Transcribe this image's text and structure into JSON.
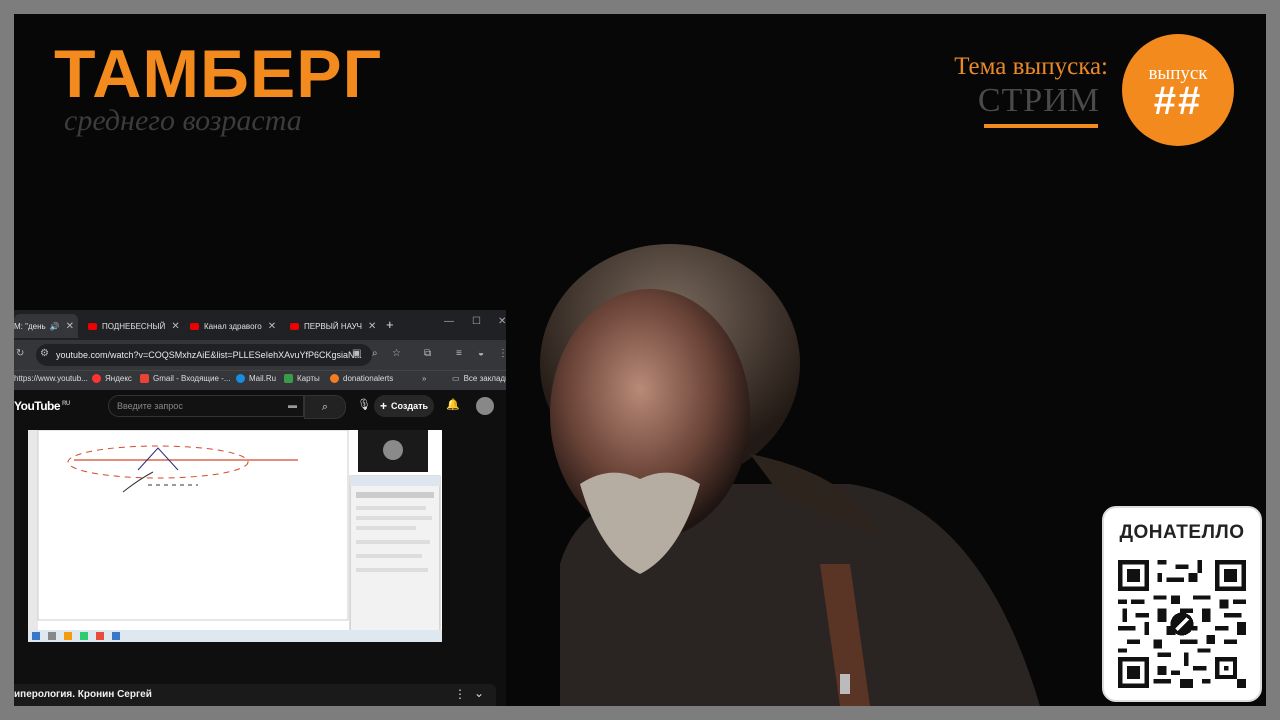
{
  "overlay": {
    "brand_main": "ТАМБЕРГ",
    "brand_sub": "среднего возраста",
    "theme_label": "Тема выпуска:",
    "theme_value": "СТРИМ",
    "badge_top": "выпуск",
    "badge_number": "##",
    "donate_title": "ДОНАТЕЛЛО",
    "accent_color": "#f28a1e"
  },
  "browser": {
    "tabs": [
      {
        "label": "M: \"день"
      },
      {
        "label": "ПОДНЕБЕСНЫЙ"
      },
      {
        "label": "Канал здравого"
      },
      {
        "label": "ПЕРВЫЙ НАУЧ"
      }
    ],
    "url": "youtube.com/watch?v=COQSMxhzAiE&list=PLLESeIehXAvuYfP6CKgsiaN...",
    "bookmarks": [
      {
        "label": "https://www.youtub..."
      },
      {
        "label": "Яндекс"
      },
      {
        "label": "Gmail - Входящие -..."
      },
      {
        "label": "Mail.Ru"
      },
      {
        "label": "Карты"
      },
      {
        "label": "donationalerts"
      },
      {
        "label": "Все закладки"
      }
    ],
    "more_bookmarks": "»"
  },
  "youtube": {
    "logo": "YouTube",
    "logo_region": "RU",
    "search_placeholder": "Введите запрос",
    "create_label": "Создать",
    "video_title": "иперология. Кронин Сергей"
  }
}
